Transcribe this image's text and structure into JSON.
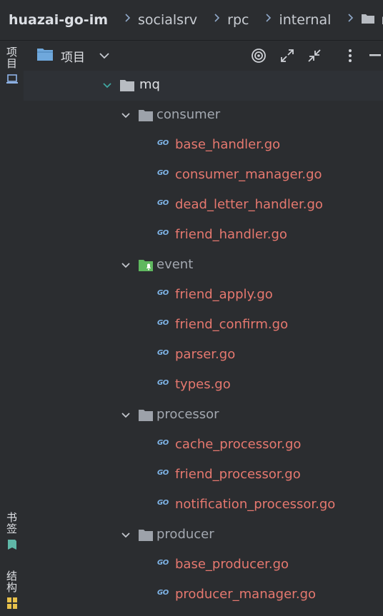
{
  "breadcrumb": {
    "root": "huazai-go-im",
    "items": [
      "socialsrv",
      "rpc",
      "internal",
      "mq"
    ]
  },
  "side_panel": {
    "top_tab": "项目",
    "bottom_tabs": [
      "书签",
      "结构"
    ]
  },
  "toolbar": {
    "title": "项目",
    "icons": [
      "folder-icon",
      "chevron-down-icon",
      "locate-icon",
      "expand-icon",
      "collapse-icon",
      "more-icon",
      "minimize-icon"
    ]
  },
  "tree": {
    "root": "mq",
    "items": [
      {
        "type": "dir",
        "name": "consumer"
      },
      {
        "type": "file",
        "name": "base_handler.go"
      },
      {
        "type": "file",
        "name": "consumer_manager.go"
      },
      {
        "type": "file",
        "name": "dead_letter_handler.go"
      },
      {
        "type": "file",
        "name": "friend_handler.go"
      },
      {
        "type": "dir",
        "name": "event"
      },
      {
        "type": "file",
        "name": "friend_apply.go"
      },
      {
        "type": "file",
        "name": "friend_confirm.go"
      },
      {
        "type": "file",
        "name": "parser.go"
      },
      {
        "type": "file",
        "name": "types.go"
      },
      {
        "type": "dir",
        "name": "processor"
      },
      {
        "type": "file",
        "name": "cache_processor.go"
      },
      {
        "type": "file",
        "name": "friend_processor.go"
      },
      {
        "type": "file",
        "name": "notification_processor.go"
      },
      {
        "type": "dir",
        "name": "producer"
      },
      {
        "type": "file",
        "name": "base_producer.go"
      },
      {
        "type": "file",
        "name": "producer_manager.go"
      }
    ],
    "file_badge": "GO"
  },
  "colors": {
    "background": "#2b2d30",
    "file_text": "#e6786f",
    "dir_text": "#a3a8b0",
    "go_badge": "#7fb5e8",
    "event_folder": "#5fb85f",
    "expand_arrow_root": "#3fa6a0"
  }
}
